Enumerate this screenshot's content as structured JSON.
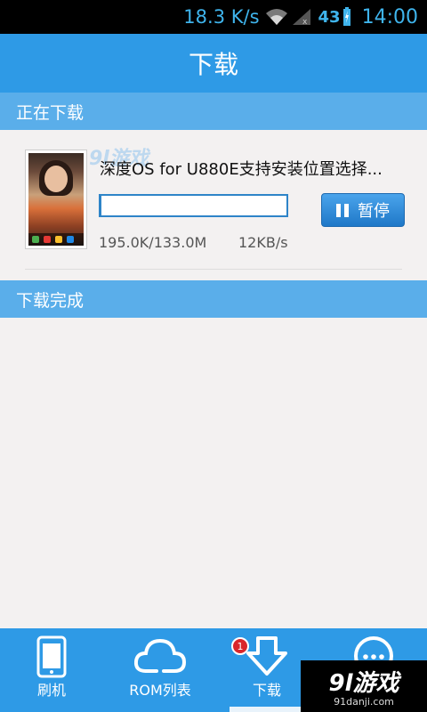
{
  "status_bar": {
    "net_speed": "18.3 K/s",
    "battery_level": "43",
    "time": "14:00",
    "icons": [
      "wifi-icon",
      "signal-icon",
      "battery-charging-icon"
    ]
  },
  "header": {
    "title": "下载"
  },
  "sections": {
    "downloading": "正在下载",
    "completed": "下载完成"
  },
  "download_item": {
    "title": "深度OS for U880E支持安装位置选择...",
    "progress": "195.0K/133.0M",
    "progress_fraction": 0.0015,
    "speed": "12KB/s",
    "pause_label": "暂停"
  },
  "watermark_small": "9l游戏",
  "tabs": [
    {
      "label": "刷机",
      "icon": "phone-icon"
    },
    {
      "label": "ROM列表",
      "icon": "cloud-icon"
    },
    {
      "label": "下载",
      "icon": "download-arrow-icon",
      "badge": "1"
    },
    {
      "label": "",
      "icon": "more-icon"
    }
  ],
  "watermark": {
    "brand": "9l游戏",
    "site": "91danji.com"
  },
  "colors": {
    "primary": "#2e9ae6",
    "section": "#5aaeea",
    "badge": "#d9262b"
  }
}
